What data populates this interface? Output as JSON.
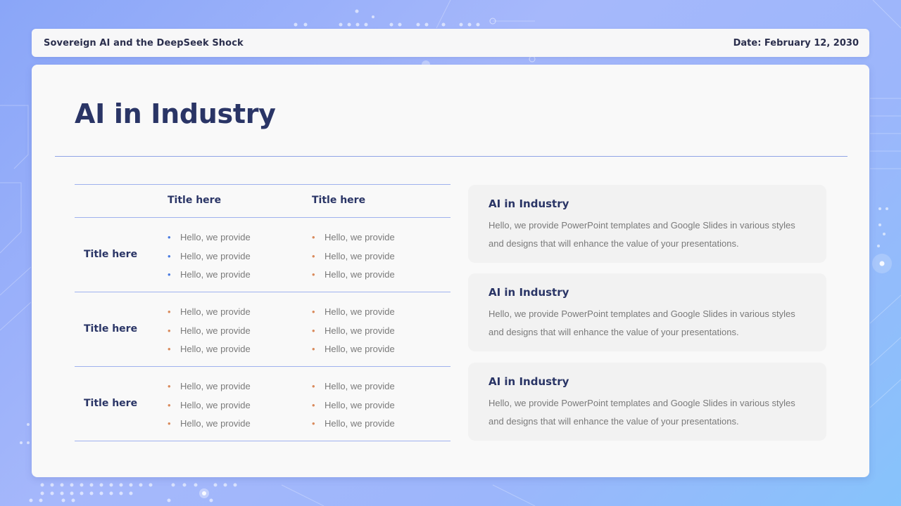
{
  "header": {
    "title": "Sovereign AI and the DeepSeek Shock",
    "date": "Date: February 12, 2030"
  },
  "page": {
    "title": "AI in Industry"
  },
  "table": {
    "columns": [
      "",
      "Title here",
      "Title here"
    ],
    "rows": [
      {
        "label": "Title here",
        "col1": [
          "Hello, we provide",
          "Hello, we provide",
          "Hello, we provide"
        ],
        "col2": [
          "Hello, we provide",
          "Hello, we provide",
          "Hello, we provide"
        ]
      },
      {
        "label": "Title here",
        "col1": [
          "Hello, we provide",
          "Hello, we provide",
          "Hello, we provide"
        ],
        "col2": [
          "Hello, we provide",
          "Hello, we provide",
          "Hello, we provide"
        ]
      },
      {
        "label": "Title here",
        "col1": [
          "Hello, we provide",
          "Hello, we provide",
          "Hello, we provide"
        ],
        "col2": [
          "Hello, we provide",
          "Hello, we provide",
          "Hello, we provide"
        ]
      }
    ]
  },
  "info_boxes": [
    {
      "title": "AI in Industry",
      "text": "Hello, we provide PowerPoint templates and Google Slides in various styles and designs that will enhance the value of your presentations."
    },
    {
      "title": "AI in Industry",
      "text": "Hello, we provide PowerPoint templates and Google Slides in various styles and designs that will enhance the value of your presentations."
    },
    {
      "title": "AI in Industry",
      "text": "Hello, we provide PowerPoint templates and Google Slides in various styles and designs that will enhance the value of your presentations."
    }
  ],
  "colors": {
    "accent_blue": "#4a7be0",
    "accent_orange": "#d98a5c",
    "title_navy": "#2a3566"
  }
}
